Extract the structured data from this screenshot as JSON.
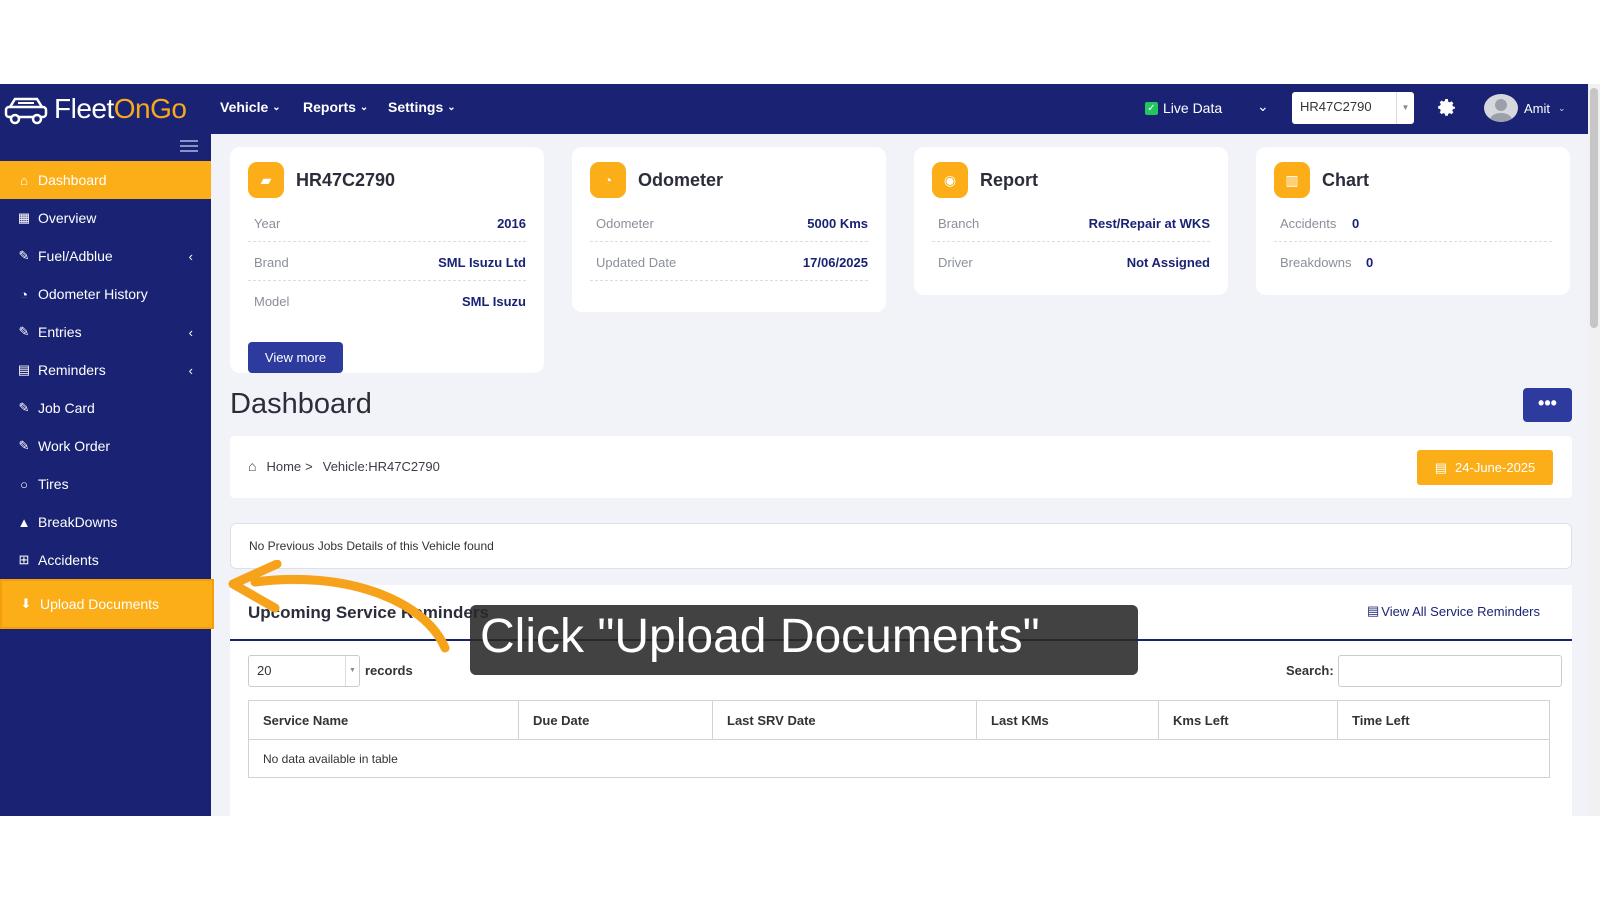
{
  "app": {
    "logo_text_1": "Fleet",
    "logo_text_2": "OnGo",
    "nav": [
      {
        "label": "Vehicle"
      },
      {
        "label": "Reports"
      },
      {
        "label": "Settings"
      }
    ],
    "live_data_label": "Live Data",
    "vehicle_select_value": "HR47C2790",
    "user_name": "Amit"
  },
  "sidebar": {
    "items": [
      {
        "label": "Dashboard",
        "icon": "home-icon"
      },
      {
        "label": "Overview",
        "icon": "grid-icon"
      },
      {
        "label": "Fuel/Adblue",
        "icon": "edit-icon"
      },
      {
        "label": "Odometer History",
        "icon": "dashboard-gauge-icon"
      },
      {
        "label": "Entries",
        "icon": "edit-icon"
      },
      {
        "label": "Reminders",
        "icon": "calendar-icon"
      },
      {
        "label": "Job Card",
        "icon": "edit-icon"
      },
      {
        "label": "Work Order",
        "icon": "edit-icon"
      },
      {
        "label": "Tires",
        "icon": "circle-icon"
      },
      {
        "label": "BreakDowns",
        "icon": "warning-icon"
      },
      {
        "label": "Accidents",
        "icon": "plus-square-icon"
      },
      {
        "label": "Upload Documents",
        "icon": "download-icon"
      }
    ]
  },
  "cards": {
    "vehicle": {
      "title": "HR47C2790",
      "rows": [
        {
          "k": "Year",
          "v": "2016"
        },
        {
          "k": "Brand",
          "v": "SML Isuzu Ltd"
        },
        {
          "k": "Model",
          "v": "SML Isuzu"
        }
      ],
      "button": "View more"
    },
    "odometer": {
      "title": "Odometer",
      "rows": [
        {
          "k": "Odometer",
          "v": "5000 Kms"
        },
        {
          "k": "Updated Date",
          "v": "17/06/2025"
        }
      ]
    },
    "report": {
      "title": "Report",
      "rows": [
        {
          "k": "Branch",
          "v": "Rest/Repair at WKS"
        },
        {
          "k": "Driver",
          "v": "Not Assigned"
        }
      ]
    },
    "chart": {
      "title": "Chart",
      "rows": [
        {
          "k": "Accidents",
          "v": "0"
        },
        {
          "k": "Breakdowns",
          "v": "0"
        }
      ]
    }
  },
  "page": {
    "title": "Dashboard",
    "dots": "•••",
    "breadcrumb": {
      "home": "Home",
      "sep": ">",
      "current": "Vehicle:HR47C2790"
    },
    "date": "24-June-2025",
    "no_jobs": "No Previous Jobs Details of this Vehicle found"
  },
  "service": {
    "title": "Upcoming Service Reminders",
    "view_all": "View All Service Reminders",
    "length_value": "20",
    "length_label": "records",
    "search_label": "Search:",
    "columns": [
      "Service Name",
      "Due Date",
      "Last SRV Date",
      "Last KMs",
      "Kms Left",
      "Time Left"
    ],
    "empty": "No data available in table"
  },
  "tutorial": {
    "callout": "Click \"Upload Documents\""
  },
  "colors": {
    "navy": "#1a2373",
    "accent": "#fbae17",
    "button": "#2d3a9e"
  }
}
